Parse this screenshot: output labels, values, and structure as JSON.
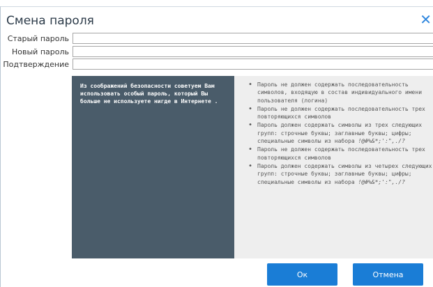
{
  "dialog": {
    "title": "Смена пароля"
  },
  "fields": [
    {
      "label": "Старый пароль",
      "value": "",
      "placeholder": ""
    },
    {
      "label": "Новый пароль",
      "value": "",
      "placeholder": ""
    },
    {
      "label": "Подтверждение",
      "value": "",
      "placeholder": ""
    }
  ],
  "security_tip": "Из соображений безопасности советуем Вам использовать особый пароль, который Вы больше не используете нигде в Интернете .",
  "rules": [
    {
      "text": "Пароль не должен содержать последовательность символов, входящую в состав индивидуального имени пользователя (логина)",
      "symbols": ""
    },
    {
      "text": "Пароль не должен содержать последовательность трех повторяющихся символов",
      "symbols": ""
    },
    {
      "text": "Пароль должен содержать символы из трех следующих групп: строчные буквы; заглавные буквы; цифры; специальные символы из набора ",
      "symbols": "!@#%&*;':\",./?"
    },
    {
      "text": "Пароль не должен содержать последовательность трех повторяющихся символов",
      "symbols": ""
    },
    {
      "text": "Пароль должен содержать символы из четырех следующих групп: строчные буквы; заглавные буквы; цифры; специальные символы из набора ",
      "symbols": "!@#%&*;':\",./?"
    }
  ],
  "buttons": {
    "ok": "Ок",
    "cancel": "Отмена"
  },
  "colors": {
    "accent": "#1a7dd6",
    "tip_panel": "#4a5c6a",
    "rules_panel": "#eeeeee"
  },
  "icons": {
    "close": "close-icon"
  }
}
